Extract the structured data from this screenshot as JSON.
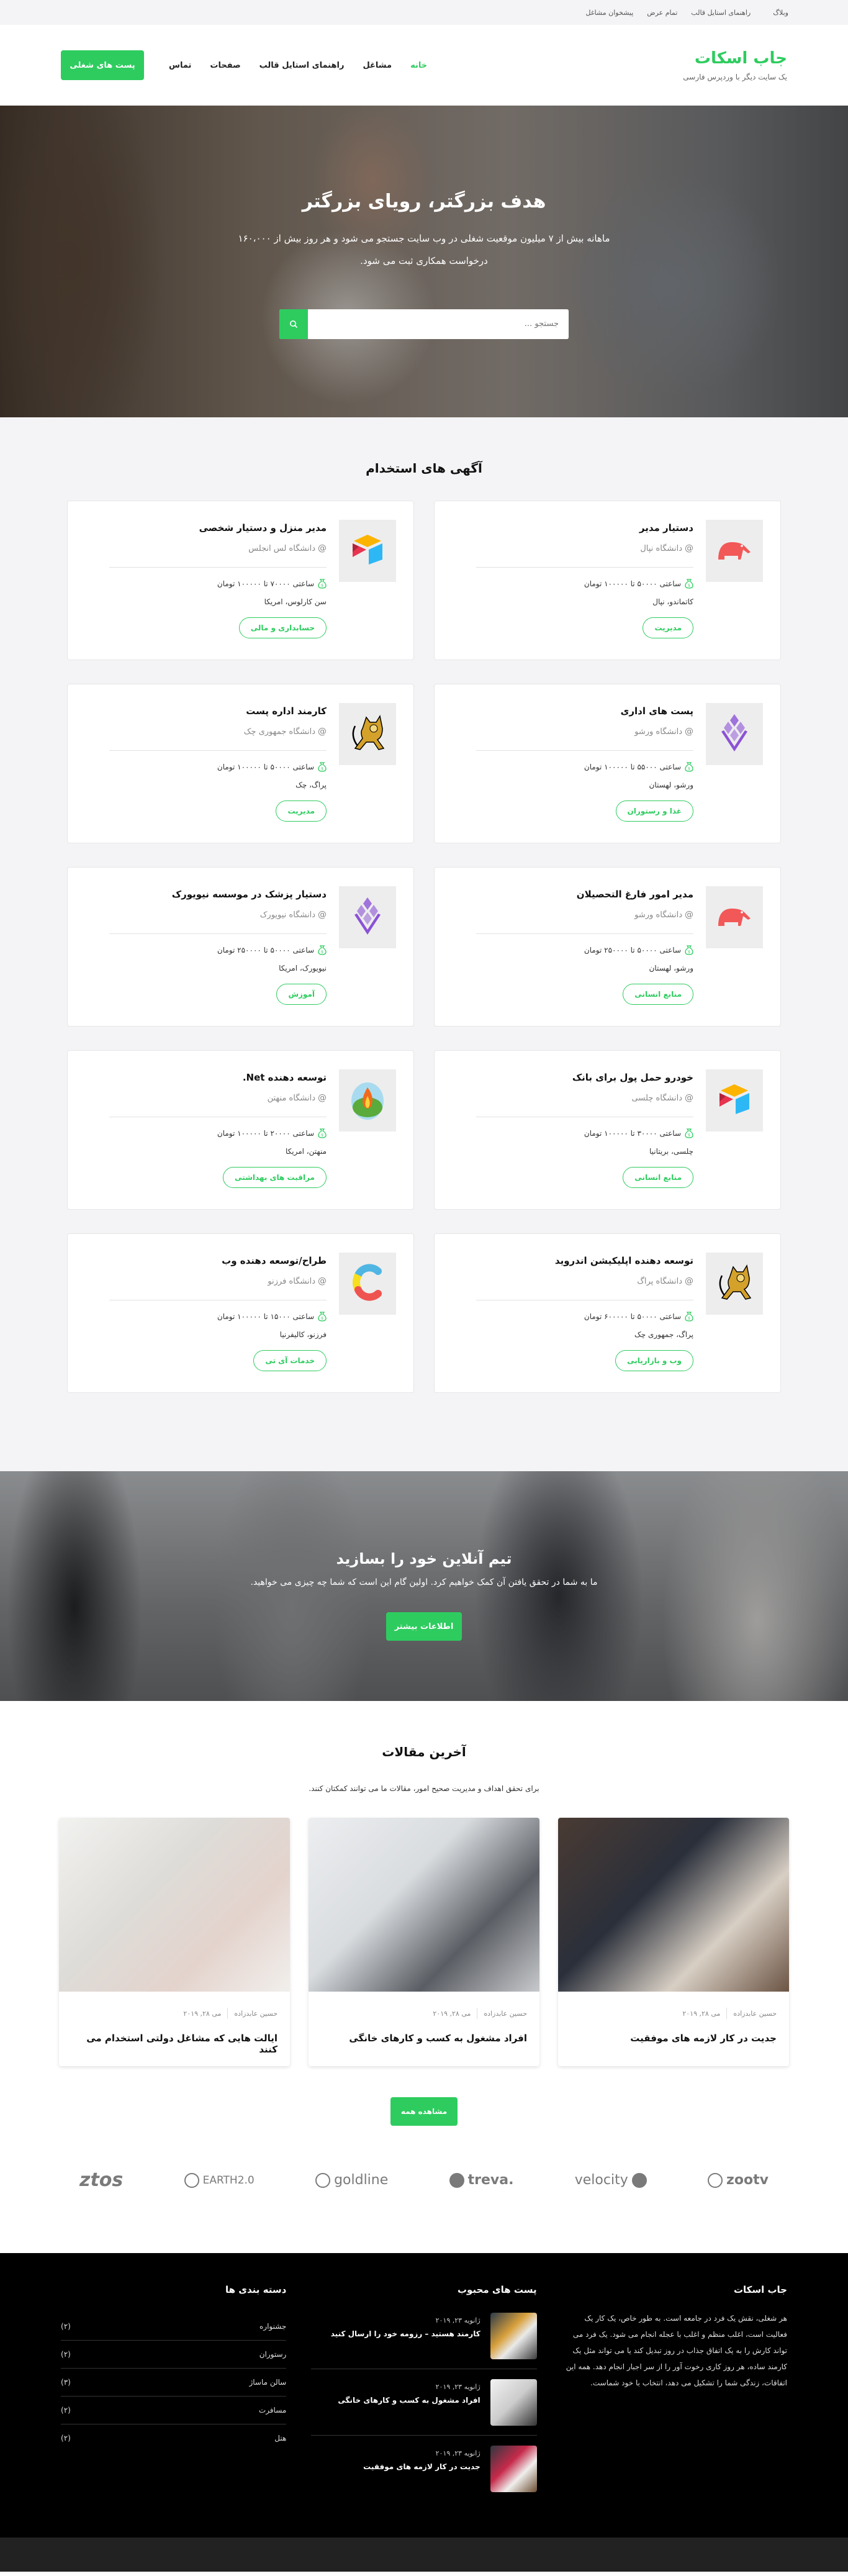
{
  "topbar": {
    "links": [
      "وبلاگ",
      "راهنمای استایل قالب",
      "تمام عرض",
      "پیشخوان مشاغل"
    ]
  },
  "header": {
    "brand_title": "جاب اسکات",
    "brand_tagline": "یک سایت دیگر با وردپرس فارسی",
    "nav": [
      "خانه",
      "مشاغل",
      "راهنمای استایل قالب",
      "صفحات",
      "تماس"
    ],
    "post_job_label": "پست های شغلی"
  },
  "hero": {
    "title": "هدف بزرگتر، رویای بزرگتر",
    "subtitle": "ماهانه بیش از ۷ میلیون موقعیت شغلی در وب سایت جستجو می شود و هر روز بیش از ۱۶۰،۰۰۰ درخواست همکاری ثبت می شود.",
    "search_placeholder": "جستجو ..."
  },
  "jobs": {
    "title": "آگهی های استخدام",
    "items": [
      {
        "logo": "anteater-logo",
        "title": "دستیار مدیر",
        "company": "دانشگاه نپال",
        "salary": "ساعتی ۵۰۰۰۰ تا ۱۰۰۰۰۰ تومان",
        "location": "کاتماندو، نپال",
        "tag": "مدیریت"
      },
      {
        "logo": "cube-logo",
        "title": "مدیر منزل و دستیار شخصی",
        "company": "دانشگاه لس انجلس",
        "salary": "ساعتی ۷۰۰۰۰ تا ۱۰۰۰۰۰ تومان",
        "location": "سن کارلوس، امریکا",
        "tag": "حسابداری و مالی"
      },
      {
        "logo": "diamond-logo",
        "title": "پست های اداری",
        "company": "دانشگاه ورشو",
        "salary": "ساعتی ۵۵۰۰۰ تا ۱۰۰۰۰۰ تومان",
        "location": "ورشو، لهستان",
        "tag": "غذا و رستوران"
      },
      {
        "logo": "tomcat-logo",
        "title": "کارمند اداره پست",
        "company": "دانشگاه جمهوری چک",
        "salary": "ساعتی ۵۰۰۰۰ تا ۱۰۰۰۰۰ تومان",
        "location": "پراگ، چک",
        "tag": "مدیریت"
      },
      {
        "logo": "anteater-logo",
        "title": "مدیر امور فارغ التحصیلان",
        "company": "دانشگاه ورشو",
        "salary": "ساعتی ۵۰۰۰۰ تا ۲۵۰۰۰۰ تومان",
        "location": "ورشو، لهستان",
        "tag": "منابع انسانی"
      },
      {
        "logo": "diamond-logo",
        "title": "دستیار پزشک در موسسه نیویورک",
        "company": "دانشگاه نیویورک",
        "salary": "ساعتی ۵۰۰۰۰ تا ۲۵۰۰۰۰ تومان",
        "location": "نیویورک، امریکا",
        "tag": "آموزش"
      },
      {
        "logo": "cube-logo",
        "title": "خودرو حمل پول برای بانک",
        "company": "دانشگاه چلسی",
        "salary": "ساعتی ۳۰۰۰۰ تا ۱۰۰۰۰۰ تومان",
        "location": "چلسی، بریتانیا",
        "tag": "منابع انسانی"
      },
      {
        "logo": "flame-logo",
        "title": "توسعه دهنده Net.",
        "company": "دانشگاه منهتن",
        "salary": "ساعتی ۲۰۰۰۰ تا ۱۰۰۰۰۰ تومان",
        "location": "منهتن، امریکا",
        "tag": "مراقبت های بهداشتی"
      },
      {
        "logo": "tomcat-logo",
        "title": "توسعه دهنده اپلیکیشن اندروید",
        "company": "دانشگاه پراگ",
        "salary": "ساعتی ۵۰۰۰۰ تا ۶۰۰۰۰۰ تومان",
        "location": "پراگ، جمهوری چک",
        "tag": "وب و بازاریابی"
      },
      {
        "logo": "c-logo",
        "title": "طراح/توسعه دهنده وب",
        "company": "دانشگاه فرزنو",
        "salary": "ساعتی ۱۵۰۰۰ تا ۱۰۰۰۰۰ تومان",
        "location": "فرزنو، کالیفرنیا",
        "tag": "خدمات آی تی"
      }
    ]
  },
  "cta": {
    "title": "تیم آنلاین خود را بسازید",
    "subtitle": "ما به شما در تحقق یافتن آن کمک خواهیم کرد. اولین گام این است که شما چه چیزی می خواهید.",
    "button": "اطلاعات بیشتر"
  },
  "articles": {
    "title": "آخرین مقالات",
    "subtitle": "برای تحقق اهداف و مدیریت صحیح امور، مقالات ما می توانند کمکتان کنند.",
    "items": [
      {
        "author": "حسین عابدزاده",
        "date": "می ۲۸, ۲۰۱۹",
        "title": "جدیت در کار لازمه های موفقیت"
      },
      {
        "author": "حسین عابدزاده",
        "date": "می ۲۸, ۲۰۱۹",
        "title": "افراد مشغول به کسب و کارهای خانگی"
      },
      {
        "author": "حسین عابدزاده",
        "date": "می ۲۸, ۲۰۱۹",
        "title": "ایالت هایی که مشاغل دولتی استخدام می کنند"
      }
    ],
    "see_all": "مشاهده همه"
  },
  "logos": [
    "ztos",
    "EARTH2.0",
    "goldline",
    "treva.",
    "velocity",
    "zootv"
  ],
  "footer": {
    "about_title": "جاب اسکات",
    "about_text": "هر شغلی، نقش یک فرد در جامعه است. به طور خاص، یک کار یک فعالیت است، اغلب منظم و اغلب با عجله انجام می شود. یک فرد می تواند کارش را به یک اتفاق جذاب در روز تبدیل کند یا می تواند مثل یک کارمند ساده، هر روز کاری رخوت آور را از سر اجبار انجام دهد. همه این اتفاقات، زندگی شما را تشکیل می دهد، انتخاب با خود شماست.",
    "popular_title": "پست های محبوب",
    "popular": [
      {
        "date": "ژانویه ۲۳, ۲۰۱۹",
        "title": "کارمند هستید – رزومه خود را ارسال کنید"
      },
      {
        "date": "ژانویه ۲۳, ۲۰۱۹",
        "title": "افراد مشغول به کسب و کارهای خانگی"
      },
      {
        "date": "ژانویه ۲۳, ۲۰۱۹",
        "title": "جدیت در کار لازمه های موفقیت"
      }
    ],
    "categories_title": "دسته بندی ها",
    "categories": [
      {
        "name": "جشنواره",
        "count": "(۲)"
      },
      {
        "name": "رستوران",
        "count": "(۲)"
      },
      {
        "name": "سالن ماساژ",
        "count": "(۳)"
      },
      {
        "name": "مسافرت",
        "count": "(۲)"
      },
      {
        "name": "هتل",
        "count": "(۲)"
      }
    ]
  },
  "colors": {
    "accent": "#2ecc5f",
    "footer_bg": "#000000",
    "bottom_bar": "#222222",
    "section_bg": "#f4f4f6"
  }
}
